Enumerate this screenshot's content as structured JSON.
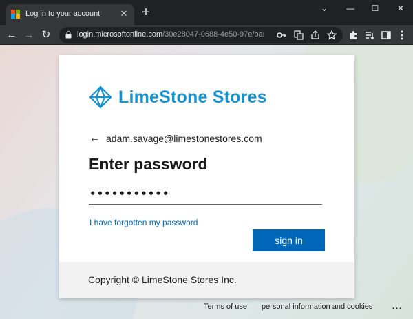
{
  "browser": {
    "tab_title": "Log in to your account",
    "tab_close": "✕",
    "new_tab": "+",
    "favicon_colors": [
      "#f25022",
      "#7fba00",
      "#00a4ef",
      "#ffb900"
    ],
    "window_controls": {
      "dropdown": "⌄",
      "minimize": "—",
      "maximize": "☐",
      "close": "✕"
    },
    "nav": {
      "back": "←",
      "forward": "→",
      "reload": "↻"
    },
    "url_host": "login.microsoftonline.com",
    "url_path": "/30e28047-0688-4e50-97e/oaut...",
    "omnibox_icons": [
      "key-icon",
      "translate-icon",
      "share-icon",
      "bookmark-star-icon"
    ],
    "toolbar_icons": [
      "extensions-icon",
      "reading-list-icon",
      "side-panel-icon",
      "menu-icon"
    ]
  },
  "brand": {
    "name": "LimeStone Stores",
    "color": "#1593d0"
  },
  "signin": {
    "back_arrow": "←",
    "email": "adam.savage@limestonestores.com",
    "title": "Enter password",
    "password_value": "•••••••••••",
    "forgot_link": "I have forgotten my password",
    "submit_label": "sign in",
    "accent_color": "#0067b8"
  },
  "card_footer": {
    "copyright": "Copyright © LimeStone Stores Inc."
  },
  "page_footer": {
    "terms": "Terms of use",
    "privacy": "personal information and cookies",
    "more": "..."
  }
}
